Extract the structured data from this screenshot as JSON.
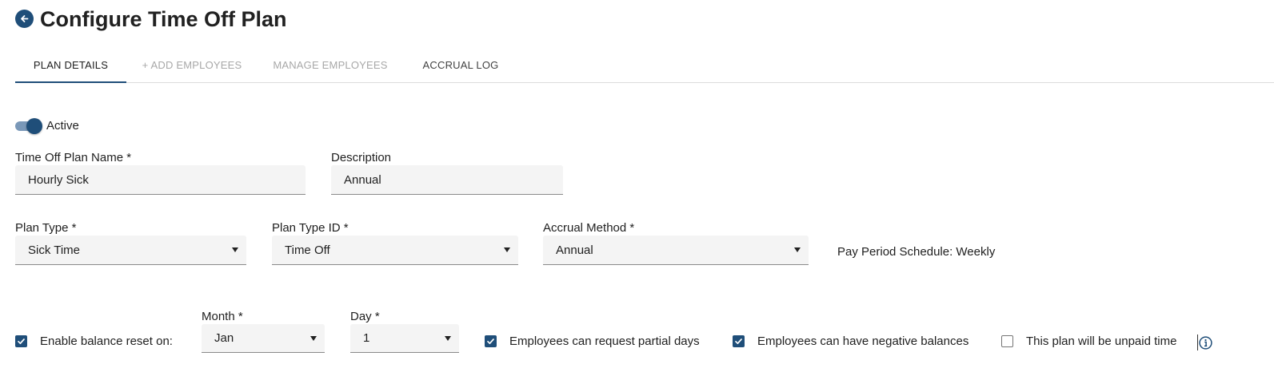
{
  "header": {
    "title": "Configure Time Off Plan",
    "back_icon": "arrow-left-circle-icon",
    "accent_color": "#1f4e79"
  },
  "tabs": [
    {
      "label": "PLAN DETAILS",
      "state": "active"
    },
    {
      "label": "+ ADD EMPLOYEES",
      "state": "disabled"
    },
    {
      "label": "MANAGE EMPLOYEES",
      "state": "disabled"
    },
    {
      "label": "ACCRUAL LOG",
      "state": "normal"
    }
  ],
  "status": {
    "active": true,
    "label": "Active"
  },
  "plan_name": {
    "label": "Time Off Plan Name *",
    "value": "Hourly Sick"
  },
  "description": {
    "label": "Description",
    "value": "Annual"
  },
  "plan_type": {
    "label": "Plan Type *",
    "value": "Sick Time"
  },
  "plan_type_id": {
    "label": "Plan Type ID *",
    "value": "Time Off"
  },
  "accrual_method": {
    "label": "Accrual Method *",
    "value": "Annual"
  },
  "pay_period": {
    "text": "Pay Period Schedule: Weekly"
  },
  "balance_reset": {
    "checked": true,
    "label": "Enable balance reset on:",
    "month": {
      "label": "Month *",
      "value": "Jan"
    },
    "day": {
      "label": "Day *",
      "value": "1"
    }
  },
  "options": {
    "partial_days": {
      "checked": true,
      "label": "Employees can request partial days"
    },
    "negative_balances": {
      "checked": true,
      "label": "Employees can have negative balances"
    },
    "unpaid_time": {
      "checked": false,
      "label": "This plan will be unpaid time"
    }
  },
  "info_icon": "info-circle-icon"
}
